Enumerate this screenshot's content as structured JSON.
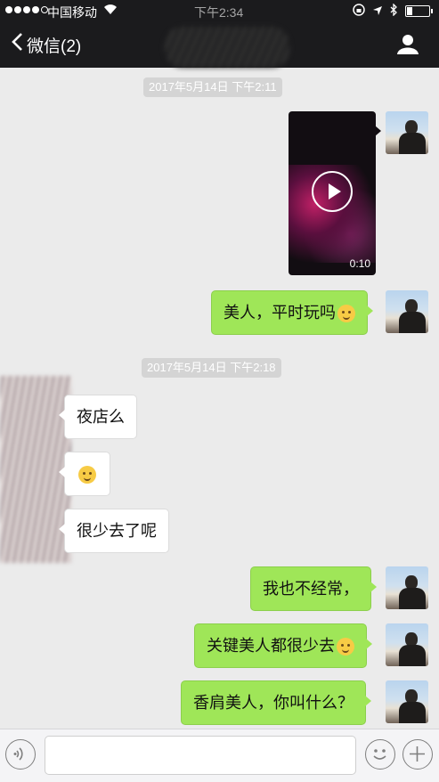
{
  "status_bar": {
    "carrier": "中国移动",
    "time": "下午2:34"
  },
  "nav": {
    "back_label": "微信(2)"
  },
  "messages": [
    {
      "type": "timestamp",
      "text": "2017年5月14日 下午2:11"
    },
    {
      "type": "video",
      "side": "out",
      "duration": "0:10"
    },
    {
      "type": "text",
      "side": "out",
      "text": "美人，平时玩吗",
      "emoji": "smile-emoji"
    },
    {
      "type": "timestamp",
      "text": "2017年5月14日 下午2:18"
    },
    {
      "type": "text",
      "side": "in",
      "text": "夜店么"
    },
    {
      "type": "emoji",
      "side": "in",
      "emoji": "flushed-emoji"
    },
    {
      "type": "text",
      "side": "in",
      "text": "很少去了呢"
    },
    {
      "type": "text",
      "side": "out",
      "text": "我也不经常，"
    },
    {
      "type": "text",
      "side": "out",
      "text": "关键美人都很少去",
      "emoji": "hug-emoji"
    },
    {
      "type": "text",
      "side": "out",
      "text": "香肩美人，你叫什么？"
    }
  ],
  "input_bar": {
    "input_value": ""
  },
  "colors": {
    "outgoing_bubble": "#9fe658",
    "incoming_bubble": "#ffffff",
    "background": "#ebebeb",
    "header": "#1b1b1d"
  }
}
